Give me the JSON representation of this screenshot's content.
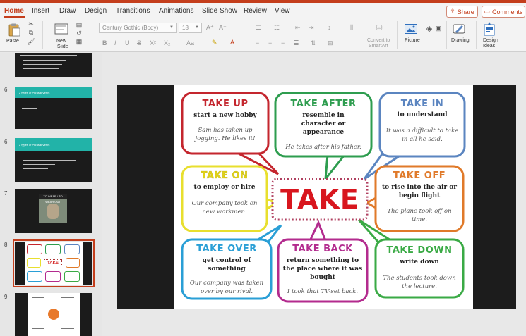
{
  "ribbon_tabs": [
    "Home",
    "Insert",
    "Draw",
    "Design",
    "Transitions",
    "Animations",
    "Slide Show",
    "Review",
    "View"
  ],
  "share_label": "Share",
  "comments_label": "Comments",
  "ribbon": {
    "paste": "Paste",
    "new_slide_line1": "New",
    "new_slide_line2": "Slide",
    "font_name": "Century Gothic (Body)",
    "font_size": "18",
    "convert_line1": "Convert to",
    "convert_line2": "SmartArt",
    "picture": "Picture",
    "drawing": "Drawing",
    "design_ideas_line1": "Design",
    "design_ideas_line2": "Ideas"
  },
  "thumbnails": [
    {
      "number": "",
      "kind": "text"
    },
    {
      "number": "6",
      "kind": "title",
      "title": "2 types of Phrasal Verbs"
    },
    {
      "number": "6",
      "kind": "title",
      "title": "2 types of Phrasal Verbs"
    },
    {
      "number": "7",
      "kind": "image",
      "title": "TO WEAR / TO WEAR OUT"
    },
    {
      "number": "8",
      "kind": "poster",
      "selected": true
    },
    {
      "number": "9",
      "kind": "diagram"
    }
  ],
  "poster": {
    "center": "TAKE",
    "bubbles": [
      {
        "title": "TAKE UP",
        "meaning": "start a new hobby",
        "example": "Sam has taken up jogging. He likes it!",
        "color": "#c4262e"
      },
      {
        "title": "TAKE AFTER",
        "meaning": "resemble in character or appearance",
        "example": "He takes after his father.",
        "color": "#2e9d4f"
      },
      {
        "title": "TAKE IN",
        "meaning": "to understand",
        "example": "It was a difficult to take in all he said.",
        "color": "#5b85c0"
      },
      {
        "title": "TAKE ON",
        "meaning": "to employ or hire",
        "example": "Our company took on new workmen.",
        "color": "#e8df2e"
      },
      {
        "title": "TAKE OFF",
        "meaning": "to rise into the air or begin flight",
        "example": "The plane took off on time.",
        "color": "#e07a2a"
      },
      {
        "title": "TAKE OVER",
        "meaning": "get control of something",
        "example": "Our company was taken over by our rival.",
        "color": "#2a9fd6"
      },
      {
        "title": "TAKE BACK",
        "meaning": "return something to the place where it was bought",
        "example": "I took that TV-set back.",
        "color": "#b32b8e"
      },
      {
        "title": "TAKE DOWN",
        "meaning": "write down",
        "example": "The students took down the lecture.",
        "color": "#3aaa45"
      }
    ]
  }
}
